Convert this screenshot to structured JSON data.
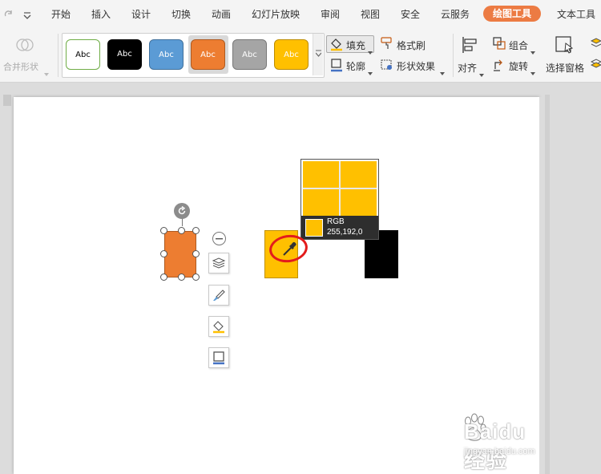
{
  "menu": {
    "items": [
      "开始",
      "插入",
      "设计",
      "切换",
      "动画",
      "幻灯片放映",
      "审阅",
      "视图",
      "安全",
      "云服务",
      "绘图工具",
      "文本工具"
    ],
    "active_index": 10
  },
  "ribbon": {
    "merge_shape": "合并形状",
    "style_label": "Abc",
    "style_colors": [
      "#ffffff",
      "#000000",
      "#5b9bd5",
      "#ed7d31",
      "#a5a5a5",
      "#ffc000"
    ],
    "fill_label": "填充",
    "outline_label": "轮廓",
    "format_painter": "格式刷",
    "shape_effects": "形状效果",
    "align_label": "对齐",
    "group_label": "组合",
    "rotate_label": "旋转",
    "selection_pane": "选择窗格"
  },
  "shapes": {
    "orange": "#ed7d31",
    "yellow": "#ffc000",
    "black": "#000000"
  },
  "magnifier": {
    "mode": "RGB",
    "value": "255,192,0",
    "color": "#ffc000"
  },
  "watermark": {
    "main": "Baidu经验",
    "sub": "jingyan.baidu.com"
  }
}
